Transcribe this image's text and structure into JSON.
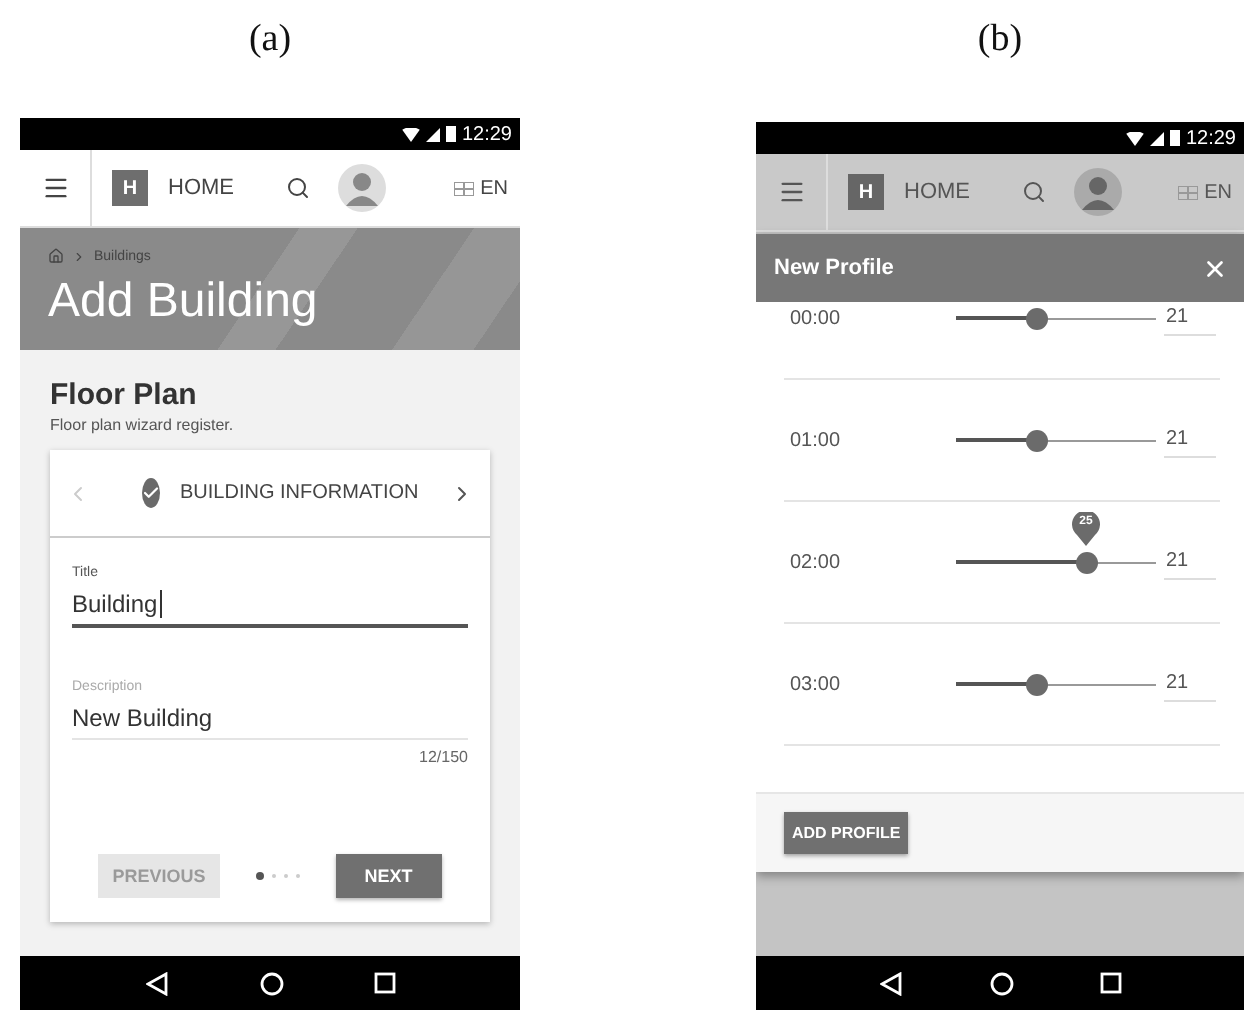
{
  "screen_a": {
    "caption": "(a)",
    "status_time": "12:29",
    "app_bar": {
      "logo": "H",
      "home": "HOME",
      "language": "EN"
    },
    "breadcrumb": "Buildings",
    "page_title": "Add Building",
    "card_title": "Floor Plan",
    "card_subtitle": "Floor plan wizard register.",
    "step_label": "BUILDING INFORMATION",
    "fields": [
      {
        "label": "Title",
        "value": "Building",
        "focused": true
      },
      {
        "label": "Description",
        "value": "New Building",
        "counter": "12/150",
        "focused": false
      }
    ],
    "buttons": [
      {
        "kind": "previous",
        "label": "PREVIOUS",
        "disabled": true
      },
      {
        "kind": "next",
        "label": "NEXT",
        "disabled": false
      }
    ],
    "step_dots": [
      {
        "selected": true
      },
      {
        "selected": false
      },
      {
        "selected": false
      },
      {
        "selected": false
      }
    ]
  },
  "screen_b": {
    "caption": "(b)",
    "status_time": "12:29",
    "app_bar": {
      "logo": "H",
      "home": "HOME",
      "language": "EN"
    },
    "dialog_title": "New Profile",
    "rows": [
      {
        "time": "00:00",
        "level": 0.4,
        "value": "21"
      },
      {
        "time": "01:00",
        "level": 0.4,
        "value": "21"
      },
      {
        "time": "02:00",
        "level": 0.65,
        "value": "21",
        "tooltip": "25"
      },
      {
        "time": "03:00",
        "level": 0.4,
        "value": "21"
      }
    ],
    "button": "ADD PROFILE"
  }
}
